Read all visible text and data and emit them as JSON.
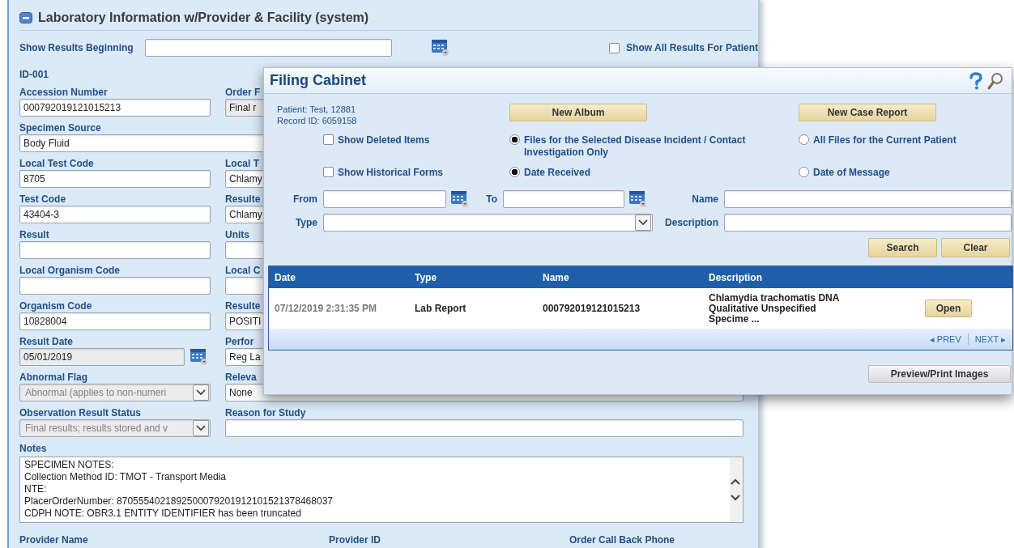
{
  "section": {
    "title": "Laboratory Information w/Provider & Facility (system)",
    "expanded": true
  },
  "show_results": {
    "label": "Show Results Beginning"
  },
  "show_all_results": {
    "label": "Show All Results For Patient",
    "checked": false
  },
  "record_label": "ID-001",
  "rows": [
    {
      "left": {
        "label": "Accession Number",
        "value": "000792019121015213",
        "kind": "text",
        "disabled": false
      },
      "right": {
        "label": "Order F",
        "value": "Final r",
        "kind": "text",
        "disabled": true
      }
    },
    {
      "full": {
        "label": "Specimen Source",
        "value": "Body Fluid",
        "kind": "text",
        "disabled": false
      }
    },
    {
      "left": {
        "label": "Local Test Code",
        "value": "8705",
        "kind": "text",
        "disabled": false
      },
      "right": {
        "label": "Local T",
        "value": "Chlamy",
        "kind": "text",
        "disabled": false
      }
    },
    {
      "left": {
        "label": "Test Code",
        "value": "43404-3",
        "kind": "text",
        "disabled": false
      },
      "right": {
        "label": "Resulte",
        "value": "Chlamy",
        "kind": "text",
        "disabled": false
      }
    },
    {
      "left": {
        "label": "Result",
        "kind": "text",
        "disabled": false
      },
      "right": {
        "label": "Units",
        "kind": "text",
        "disabled": false
      }
    },
    {
      "left": {
        "label": "Local Organism Code",
        "kind": "text",
        "disabled": false
      },
      "right": {
        "label": "Local C",
        "kind": "text",
        "disabled": false
      }
    },
    {
      "left": {
        "label": "Organism Code",
        "value": "10828004",
        "kind": "text",
        "disabled": false
      },
      "right": {
        "label": "Resulte",
        "value": "POSITI",
        "kind": "text",
        "disabled": false
      }
    },
    {
      "left": {
        "label": "Result Date",
        "value": "05/01/2019",
        "kind": "date",
        "disabled": true
      },
      "right": {
        "label": "Perfor",
        "value": "Reg La",
        "kind": "text",
        "disabled": false
      }
    },
    {
      "left": {
        "label": "Abnormal Flag",
        "value": "Abnormal (applies to non-numeri",
        "kind": "select",
        "disabled": true
      },
      "right": {
        "label": "Releva",
        "value": "None",
        "kind": "text",
        "disabled": false
      }
    },
    {
      "left": {
        "label": "Observation Result Status",
        "value": "Final results; results stored and v",
        "kind": "select",
        "disabled": true
      },
      "right": {
        "label": "Reason for Study",
        "kind": "text",
        "disabled": false
      }
    }
  ],
  "notes": {
    "label": "Notes",
    "lines": [
      "SPECIMEN NOTES:",
      "Collection Method ID: TMOT - Transport Media",
      "NTE:",
      "PlacerOrderNumber: 8705554021892500079201912101521378468037",
      "CDPH NOTE: OBR3.1 ENTITY IDENTIFIER has been truncated"
    ]
  },
  "footer_labels": [
    "Provider Name",
    "Provider ID",
    "Order Call Back Phone"
  ],
  "dialog": {
    "title": "Filing Cabinet",
    "patient": "Patient: Test, 12881",
    "record_id": "Record ID: 6059158",
    "new_buttons": [
      "New Album",
      "New Case Report"
    ],
    "checkboxes": [
      {
        "label": "Show Deleted Items",
        "checked": false
      },
      {
        "label": "Show Historical Forms",
        "checked": false
      }
    ],
    "scope_options": [
      {
        "label": "Files for the Selected Disease Incident / Contact Investigation Only",
        "selected": true
      },
      {
        "label": "All Files for the Current Patient",
        "selected": false
      }
    ],
    "date_options": [
      {
        "label": "Date Received",
        "selected": true
      },
      {
        "label": "Date of Message",
        "selected": false
      }
    ],
    "filters": {
      "from": "From",
      "to": "To",
      "name": "Name",
      "type": "Type",
      "description": "Description"
    },
    "actions": [
      "Search",
      "Clear"
    ],
    "table": {
      "columns": [
        "Date",
        "Type",
        "Name",
        "Description"
      ],
      "rows": [
        {
          "date": "07/12/2019 2:31:35 PM",
          "type": "Lab Report",
          "name": "000792019121015213",
          "description": "Chlamydia trachomatis DNA Qualitative Unspecified Specime ...",
          "action": "Open"
        }
      ]
    },
    "pager": [
      "◂ PREV",
      "NEXT ▸"
    ],
    "preview_button": "Preview/Print Images"
  }
}
